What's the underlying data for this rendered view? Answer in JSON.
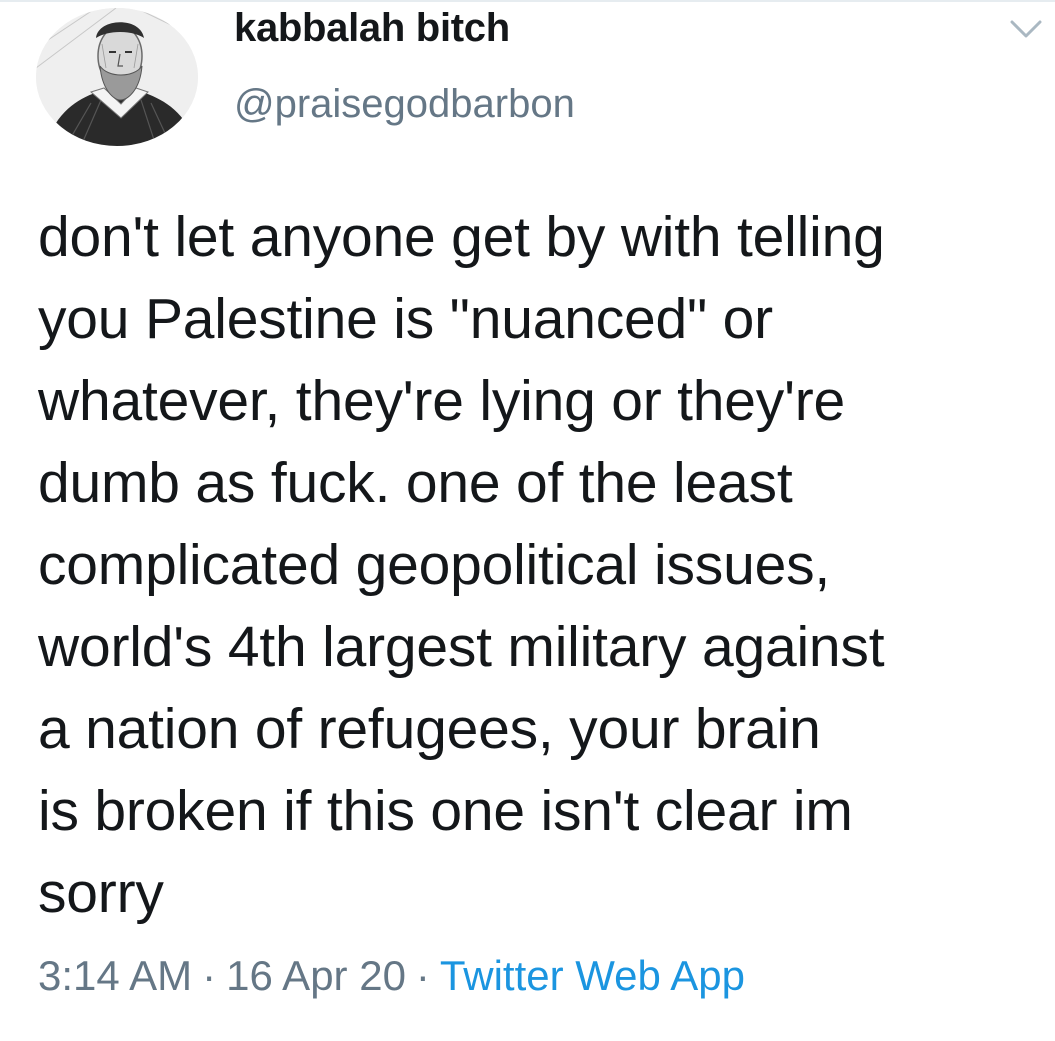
{
  "user": {
    "display_name": "kabbalah bitch",
    "handle": "@praisegodbarbon"
  },
  "tweet": {
    "text": "don't let anyone get by with telling\nyou Palestine is \"nuanced\" or\nwhatever, they're lying or they're\ndumb as fuck. one of the least\ncomplicated geopolitical issues,\nworld's 4th largest military against\na nation of refugees, your brain\nis broken if this one isn't clear im\nsorry"
  },
  "meta": {
    "time": "3:14 AM",
    "separator": "·",
    "date": "16 Apr 20",
    "source": "Twitter Web App"
  },
  "icons": {
    "avatar": "engraved-portrait-avatar",
    "menu": "chevron-down-icon"
  },
  "colors": {
    "text": "#14171a",
    "secondary": "#657786",
    "link": "#1b95e0"
  }
}
